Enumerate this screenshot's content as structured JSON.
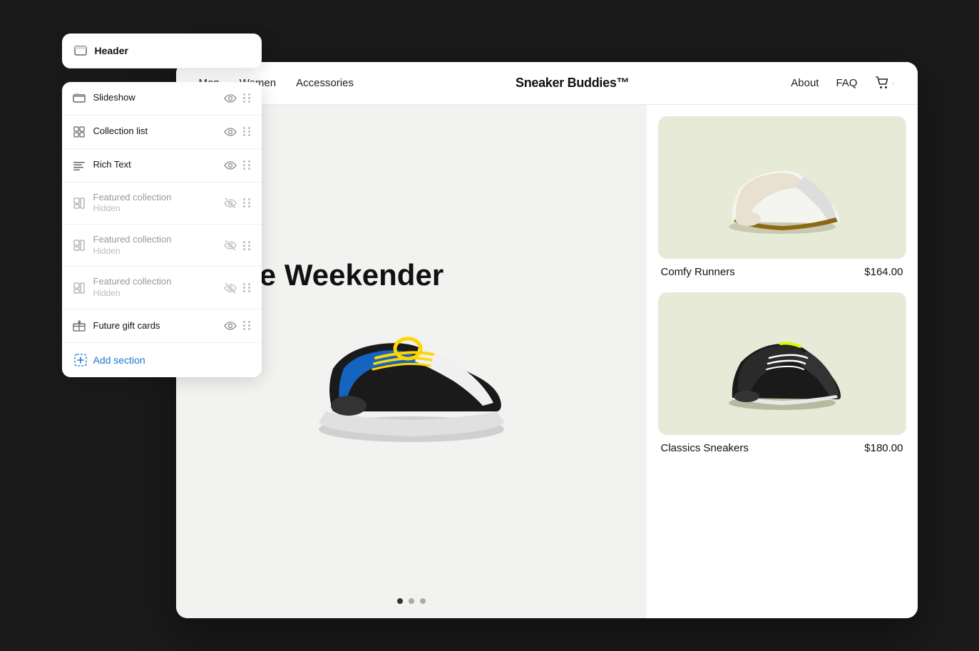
{
  "header_panel": {
    "title": "Header",
    "icon": "header-icon"
  },
  "nav": {
    "left_items": [
      "Men",
      "Women",
      "Accessories"
    ],
    "logo": "Sneaker Buddies™",
    "right_items": [
      "About",
      "FAQ"
    ],
    "cart_label": "🛒"
  },
  "hero": {
    "title": "The Weekender",
    "dots": [
      true,
      false,
      false
    ]
  },
  "products": [
    {
      "name": "Comfy Runners",
      "price": "$164.00",
      "bg_color": "#e8ead8"
    },
    {
      "name": "Classics Sneakers",
      "price": "$180.00",
      "bg_color": "#e8ead8"
    }
  ],
  "sidebar": {
    "items": [
      {
        "label": "Slideshow",
        "hidden": false,
        "icon": "slideshow-icon"
      },
      {
        "label": "Collection list",
        "hidden": false,
        "icon": "collection-icon"
      },
      {
        "label": "Rich Text",
        "hidden": false,
        "icon": "richtext-icon"
      },
      {
        "label": "Featured collection",
        "sub_label": "Hidden",
        "hidden": true,
        "icon": "featured-icon"
      },
      {
        "label": "Featured collection",
        "sub_label": "Hidden",
        "hidden": true,
        "icon": "featured-icon"
      },
      {
        "label": "Featured collection",
        "sub_label": "Hidden",
        "hidden": true,
        "icon": "featured-icon"
      },
      {
        "label": "Future gift cards",
        "hidden": false,
        "icon": "gift-icon"
      }
    ],
    "add_section_label": "Add section"
  },
  "colors": {
    "accent_blue": "#1976d2",
    "hidden_gray": "#999",
    "nav_bg": "#fff"
  }
}
